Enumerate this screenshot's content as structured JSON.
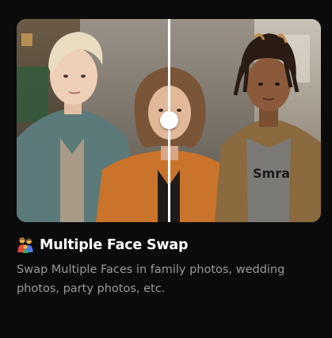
{
  "card": {
    "title": "Multiple Face Swap",
    "title_icon": "family-emoji-icon",
    "description": "Swap Multiple Faces in family photos, wedding photos, party photos, etc."
  },
  "image": {
    "shirt_text": "Smra"
  },
  "slider": {
    "position_fraction": 0.5
  },
  "colors": {
    "background": "#0b0b0b",
    "title": "#ffffff",
    "description": "#9a9a9a",
    "divider": "#ffffff"
  }
}
